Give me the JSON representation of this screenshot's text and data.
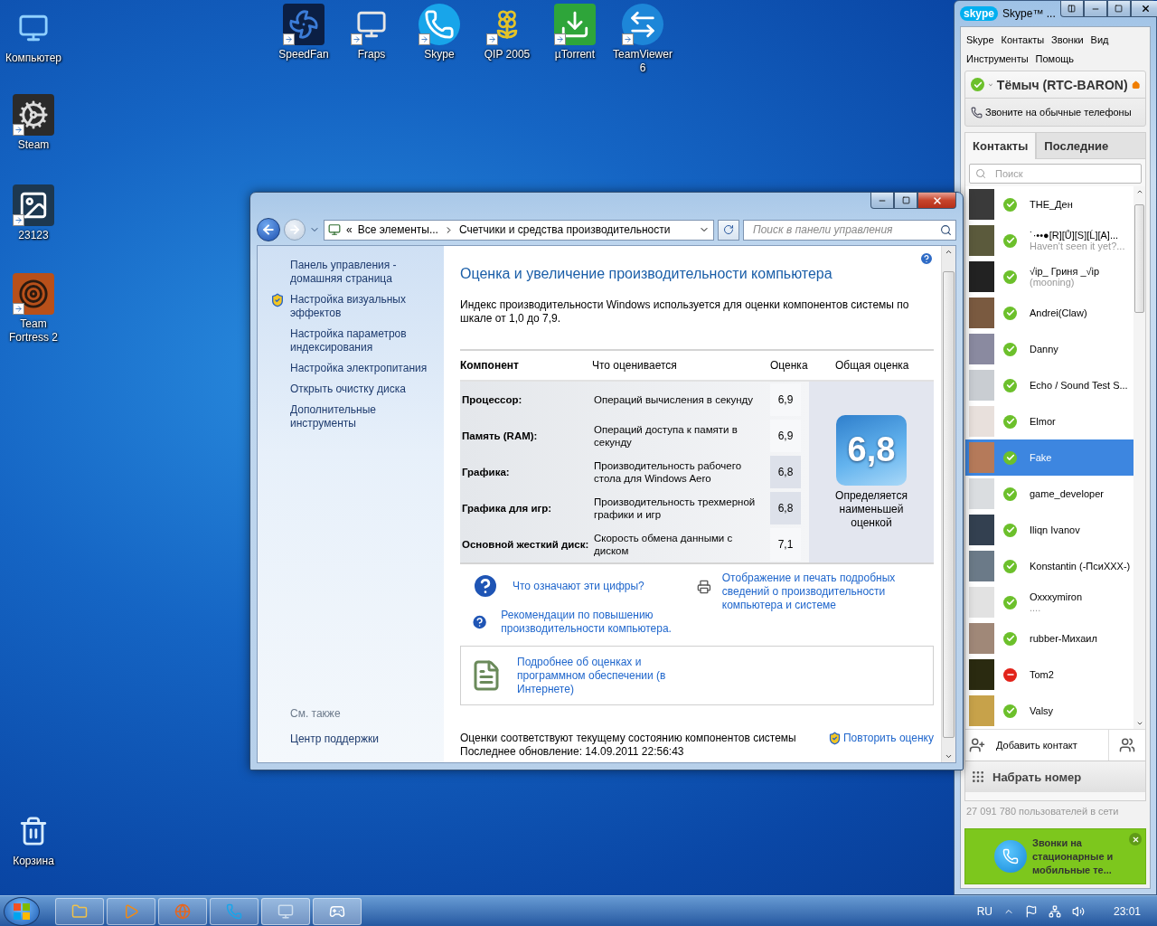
{
  "desktop_icons": [
    {
      "label": "Компьютер"
    },
    {
      "label": "Steam"
    },
    {
      "label": "23123"
    },
    {
      "label": "Team Fortress 2"
    },
    {
      "label": "Корзина"
    },
    {
      "label": "SpeedFan"
    },
    {
      "label": "Fraps"
    },
    {
      "label": "Skype"
    },
    {
      "label": "QIP 2005"
    },
    {
      "label": "µTorrent"
    },
    {
      "label": "TeamViewer 6"
    }
  ],
  "control_panel": {
    "address": {
      "overflow": "«",
      "crumbs": [
        "Все элементы...",
        "Счетчики и средства производительности"
      ]
    },
    "search": {
      "placeholder": "Поиск в панели управления"
    },
    "sidebar": {
      "links": [
        {
          "label": "Панель управления - домашняя страница",
          "shield": false
        },
        {
          "label": "Настройка визуальных эффектов",
          "shield": true
        },
        {
          "label": "Настройка параметров индексирования",
          "shield": false
        },
        {
          "label": "Настройка электропитания",
          "shield": false
        },
        {
          "label": "Открыть очистку диска",
          "shield": false
        },
        {
          "label": "Дополнительные инструменты",
          "shield": false
        }
      ],
      "see_also_heading": "См. также",
      "see_also": [
        "Центр поддержки"
      ]
    },
    "title": "Оценка и увеличение производительности компьютера",
    "intro": "Индекс производительности Windows используется для оценки компонентов системы по шкале от 1,0 до 7,9.",
    "table": {
      "columns": [
        "Компонент",
        "Что оценивается",
        "Оценка",
        "Общая оценка"
      ],
      "rows": [
        {
          "component": "Процессор:",
          "rated": "Операций вычисления в секунду",
          "score": "6,9",
          "lowest": false
        },
        {
          "component": "Память (RAM):",
          "rated": "Операций доступа к памяти в секунду",
          "score": "6,9",
          "lowest": false
        },
        {
          "component": "Графика:",
          "rated": "Производительность рабочего стола для Windows Aero",
          "score": "6,8",
          "lowest": true
        },
        {
          "component": "Графика для игр:",
          "rated": "Производительность трехмерной графики и игр",
          "score": "6,8",
          "lowest": true
        },
        {
          "component": "Основной жесткий диск:",
          "rated": "Скорость обмена данными с диском",
          "score": "7,1",
          "lowest": false
        }
      ],
      "base_score": "6,8",
      "base_note": "Определяется наименьшей оценкой"
    },
    "help_links": [
      "Что означают эти цифры?",
      "Рекомендации по повышению производительности компьютера."
    ],
    "print_link": "Отображение и печать подробных сведений о производительности компьютера и системе",
    "info_link": "Подробнее об оценках и программном обеспечении (в Интернете)",
    "status": "Оценки соответствуют текущему состоянию компонентов системы",
    "last_update": "Последнее обновление: 14.09.2011 22:56:43",
    "rerun_link": "Повторить оценку"
  },
  "skype": {
    "logo": "skype",
    "title": "Skype™ ...",
    "menu": [
      "Skype",
      "Контакты",
      "Звонки",
      "Вид",
      "Инструменты",
      "Помощь"
    ],
    "user": {
      "name": "Тёмыч (RTC-BARON)",
      "busy": false
    },
    "call_phones": "Звоните на обычные телефоны",
    "tabs": [
      {
        "label": "Контакты",
        "selected": true
      },
      {
        "label": "Последние",
        "selected": false
      }
    ],
    "search": {
      "placeholder": "Поиск"
    },
    "contacts": [
      {
        "name": "THE_Ден",
        "busy": false,
        "selected": false
      },
      {
        "name": "˙·••●[R][Ů][S][Ĺ][A]...",
        "mood": "Haven't seen it yet?...",
        "busy": false,
        "selected": false
      },
      {
        "name": "√ip_ Гриня _√ip",
        "mood": "(mooning)",
        "busy": false,
        "selected": false
      },
      {
        "name": "Andrei(Claw)",
        "busy": false,
        "selected": false
      },
      {
        "name": "Danny",
        "busy": false,
        "selected": false
      },
      {
        "name": "Echo / Sound Test S...",
        "busy": false,
        "selected": false
      },
      {
        "name": "Elmor",
        "busy": false,
        "selected": false
      },
      {
        "name": "Fake",
        "busy": false,
        "selected": true
      },
      {
        "name": "game_developer",
        "busy": false,
        "selected": false
      },
      {
        "name": "Iliqn Ivanov",
        "busy": false,
        "selected": false
      },
      {
        "name": "Konstantin (-ПсиХХХ-)",
        "busy": false,
        "selected": false
      },
      {
        "name": "Oxxxymiron",
        "mood": "....",
        "busy": false,
        "selected": false
      },
      {
        "name": "rubber-Михаил",
        "busy": false,
        "selected": false
      },
      {
        "name": "Tom2",
        "busy": true,
        "selected": false
      },
      {
        "name": "Valsy",
        "busy": false,
        "selected": false
      }
    ],
    "add_contact": "Добавить контакт",
    "dial": "Набрать номер",
    "online_count": "27 091 780 пользователей в сети",
    "promo": "Звонки на стационарные и мобильные те..."
  },
  "taskbar": {
    "language": "RU",
    "clock": "23:01"
  }
}
